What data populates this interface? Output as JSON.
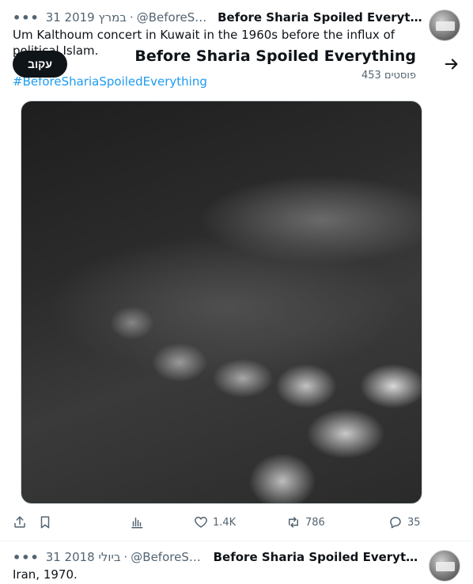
{
  "tweet1": {
    "display_name": "Before Sharia Spoiled Everyth…",
    "handle": "@BeforeSh…",
    "separator": "·",
    "date": "31 במרץ 2019",
    "more": "•••",
    "text": "Um Kalthoum concert in Kuwait in the 1960s before the influx of political Islam.",
    "hashtag": "#BeforeShariaSpoiledEverything",
    "actions": {
      "reply_count": "35",
      "retweet_count": "786",
      "like_count": "1.4K"
    }
  },
  "overlay": {
    "profile_name": "Before Sharia Spoiled Everything",
    "posts_count": "453 פוסטים",
    "follow_label": "עקוב"
  },
  "tweet2": {
    "display_name": "Before Sharia Spoiled Everyth…",
    "handle": "@BeforeSh…",
    "separator": "·",
    "date": "31 ביולי 2018",
    "more": "•••",
    "text": "Iran, 1970."
  },
  "icons": {
    "share": "share-icon",
    "bookmark": "bookmark-icon",
    "analytics": "analytics-icon",
    "like": "heart-icon",
    "retweet": "retweet-icon",
    "reply": "reply-icon",
    "back": "arrow-right-icon"
  },
  "colors": {
    "link": "#1d9bf0",
    "muted": "#536471",
    "text": "#0f1419",
    "button": "#0f1419"
  }
}
